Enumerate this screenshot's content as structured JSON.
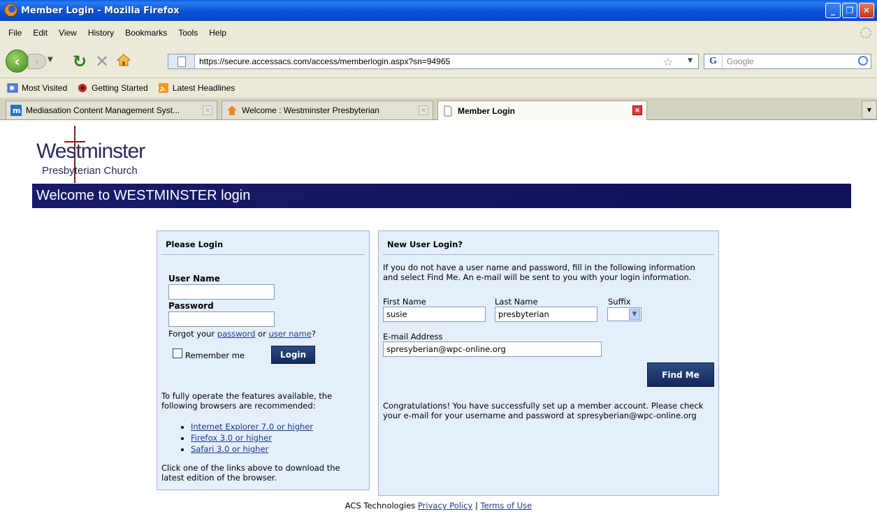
{
  "window": {
    "title": "Member Login - Mozilla Firefox",
    "controls": {
      "minimize": "_",
      "maximize": "❐",
      "close": "✕"
    }
  },
  "menu": [
    "File",
    "Edit",
    "View",
    "History",
    "Bookmarks",
    "Tools",
    "Help"
  ],
  "nav": {
    "url": "https://secure.accessacs.com/access/memberlogin.aspx?sn=94965",
    "search_placeholder": "Google"
  },
  "bookmarks": [
    "Most Visited",
    "Getting Started",
    "Latest Headlines"
  ],
  "tabs": [
    {
      "label": "Mediasation Content Management Syst...",
      "active": false
    },
    {
      "label": "Welcome : Westminster Presbyterian",
      "active": false
    },
    {
      "label": "Member Login",
      "active": true
    }
  ],
  "page": {
    "logo": {
      "line1": "Westminster",
      "line2": "Presbyterian Church"
    },
    "banner": "Welcome to WESTMINSTER login",
    "login": {
      "title": "Please Login",
      "username_label": "User Name",
      "password_label": "Password",
      "forgot_prefix": "Forgot your ",
      "forgot_password": "password",
      "forgot_or": " or ",
      "forgot_username": "user name",
      "forgot_suffix": "?",
      "remember_label": "Remember me",
      "login_button": "Login",
      "browser_note": "To fully operate the features available, the following browsers are recommended:",
      "browsers": [
        "Internet Explorer 7.0 or higher",
        "Firefox 3.0 or higher",
        "Safari 3.0 or higher"
      ],
      "download_note": "Click one of the links above to download the latest edition of the browser."
    },
    "new_user": {
      "title": "New User Login?",
      "intro": "If you do not have a user name and password, fill in the following information and select Find Me. An e-mail will be sent to you with your login information.",
      "first_name_label": "First Name",
      "first_name_value": "susie",
      "last_name_label": "Last Name",
      "last_name_value": "presbyterian",
      "suffix_label": "Suffix",
      "email_label": "E-mail Address",
      "email_value": "spresyberian@wpc-online.org",
      "find_button": "Find Me",
      "confirmation": "Congratulations! You have successfully set up a member account. Please check your e-mail for your username and password at spresyberian@wpc-online.org"
    },
    "footer": {
      "company": "ACS Technologies ",
      "privacy": "Privacy Policy",
      "separator": " | ",
      "terms": "Terms of Use"
    }
  },
  "colors": {
    "banner": "#1a1a6a",
    "panel_bg": "#e5eefb",
    "panel_border": "#9db7e4",
    "button": "#1e3570",
    "link": "#1b3a8c"
  }
}
